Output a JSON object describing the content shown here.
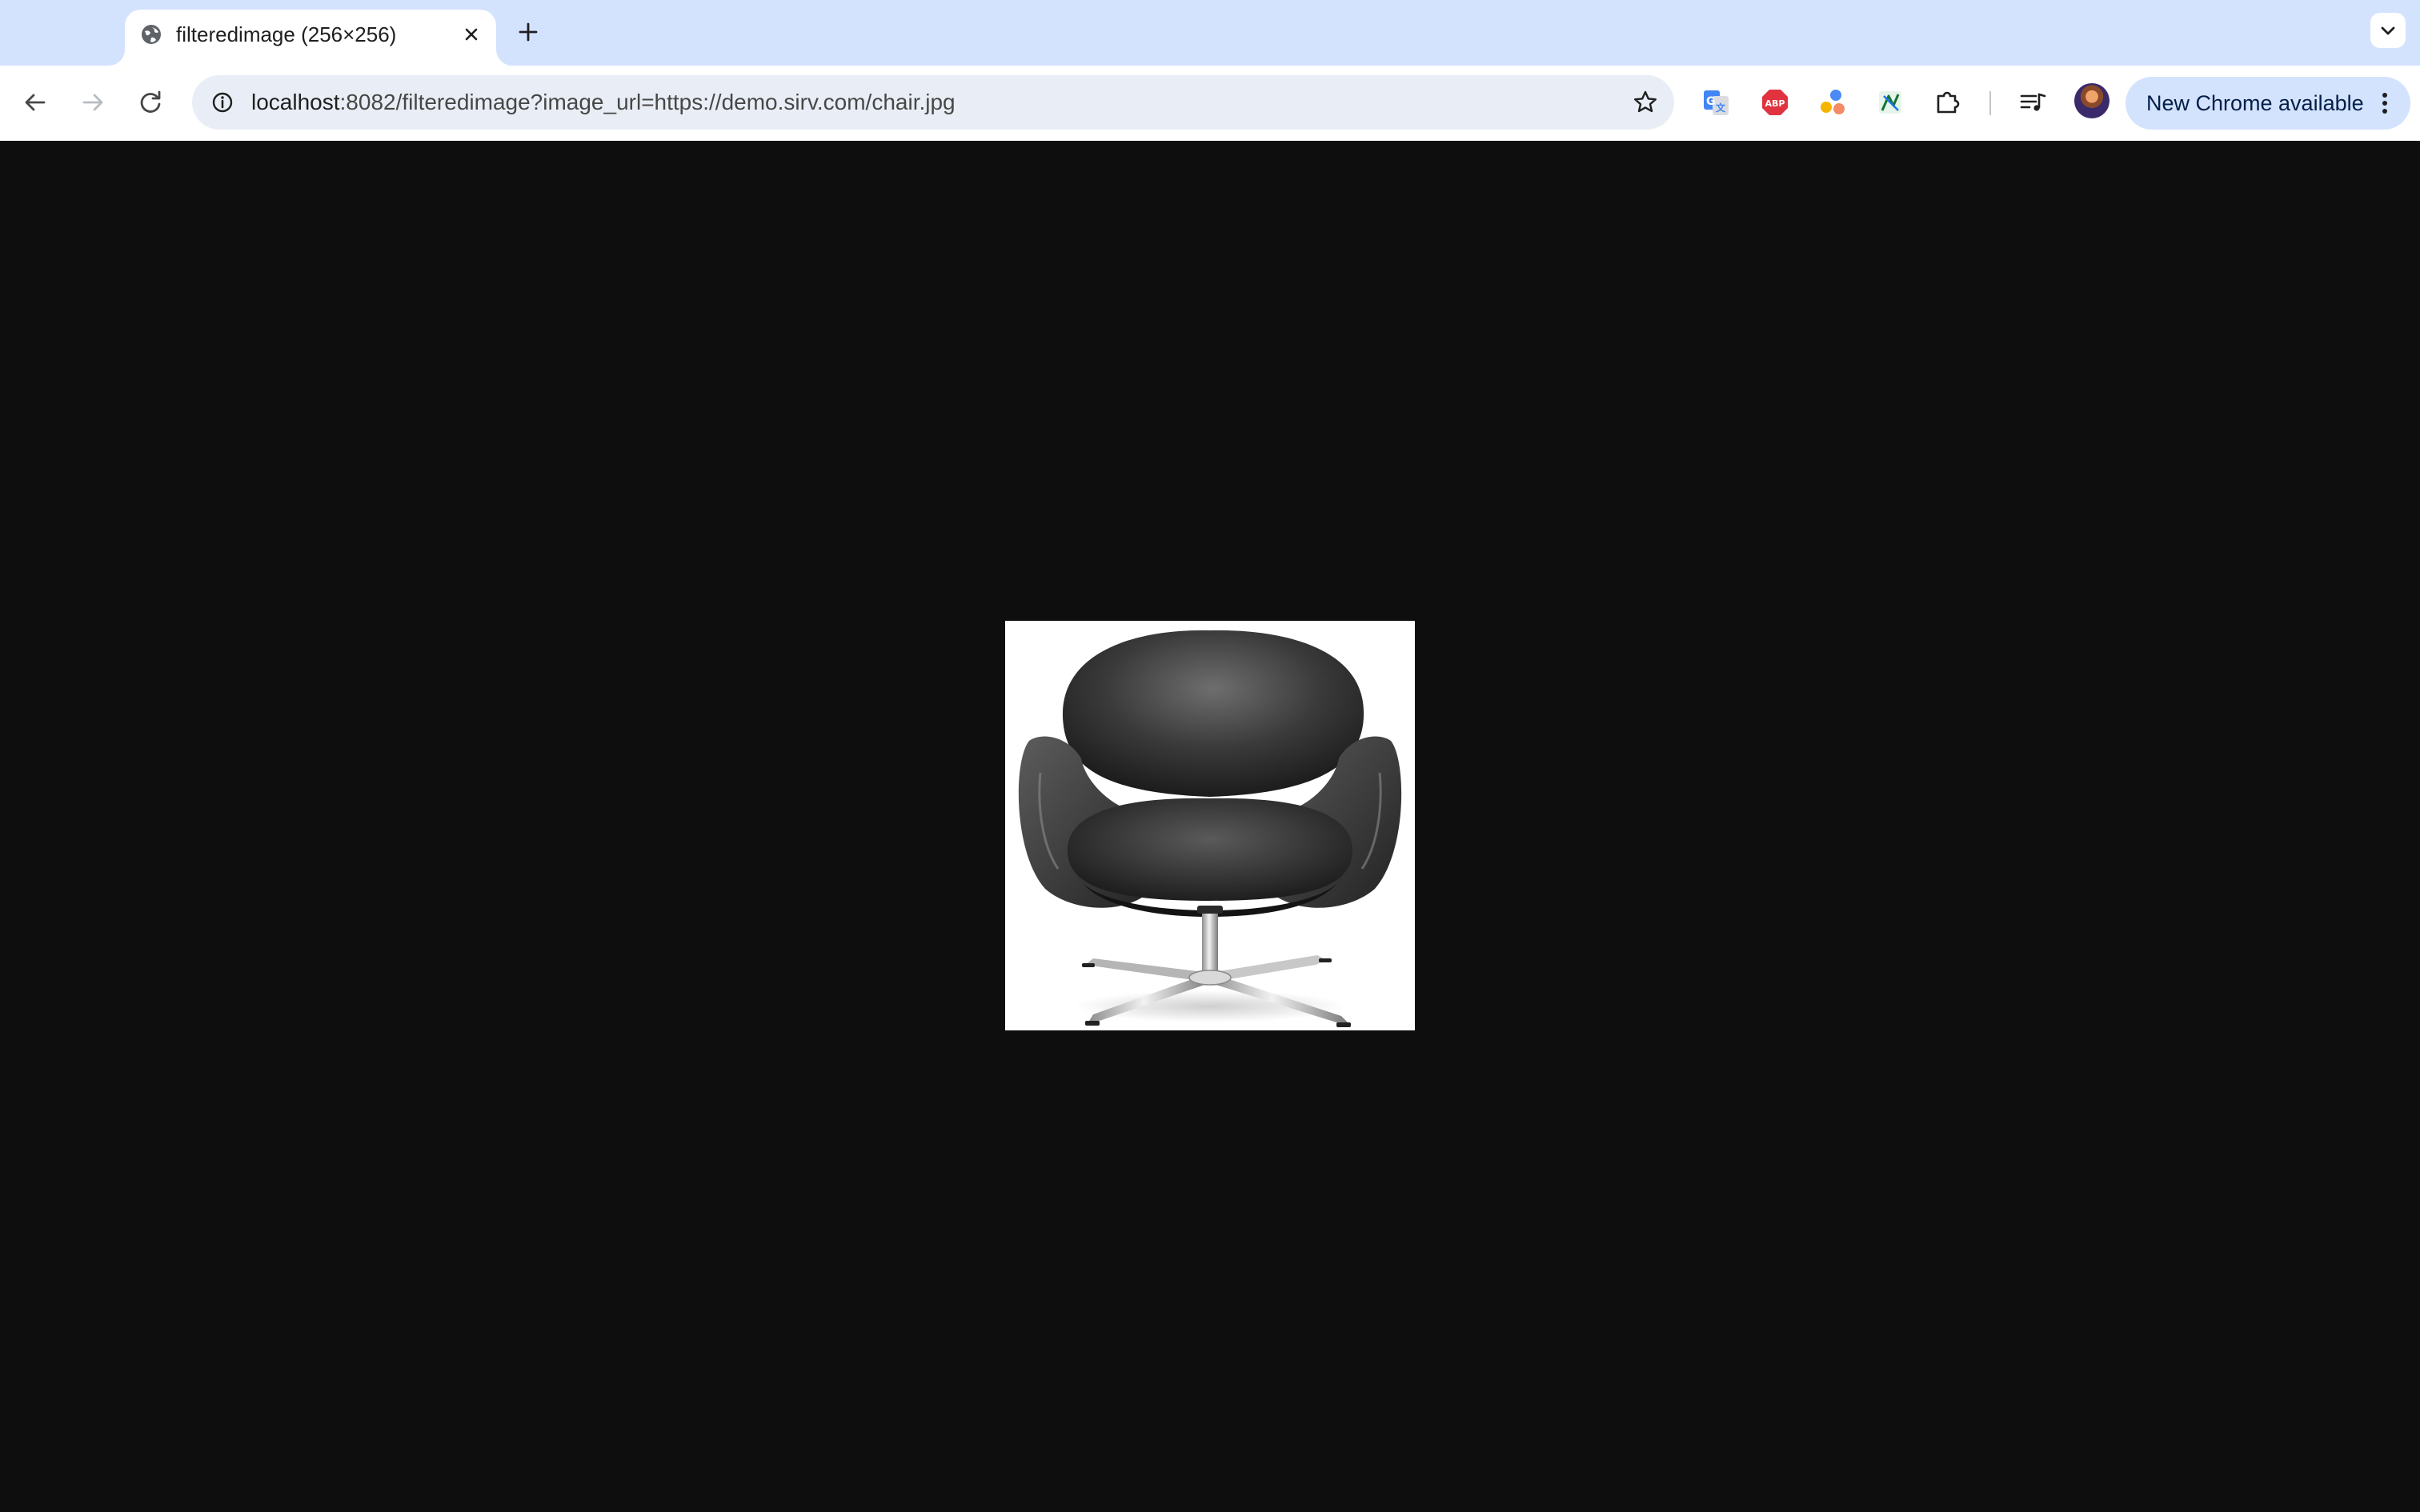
{
  "browser": {
    "tab": {
      "title": "filteredimage (256×256)",
      "favicon": "globe-icon",
      "close_icon": "close-icon"
    },
    "new_tab_icon": "plus-icon",
    "tab_search_icon": "chevron-down-icon",
    "toolbar": {
      "back_icon": "arrow-left-icon",
      "forward_icon": "arrow-right-icon",
      "reload_icon": "reload-icon"
    },
    "omnibox": {
      "site_info_icon": "info-icon",
      "url_host": "localhost",
      "url_rest": ":8082/filteredimage?image_url=https://demo.sirv.com/chair.jpg",
      "bookmark_icon": "star-icon"
    },
    "extensions": [
      {
        "name": "google-translate-icon"
      },
      {
        "name": "adblock-plus-icon",
        "label": "ABP"
      },
      {
        "name": "color-dots-extension-icon"
      },
      {
        "name": "green-extension-icon"
      },
      {
        "name": "puzzle-extensions-icon"
      }
    ],
    "media_icon": "media-controls-icon",
    "profile_avatar": "avatar",
    "update_chip": {
      "label": "New Chrome available",
      "menu_icon": "three-dots-vertical-icon"
    }
  },
  "page": {
    "background": "#0e0e0e",
    "image": {
      "subject": "swan-chair-image",
      "natural_size": "256×256"
    }
  }
}
